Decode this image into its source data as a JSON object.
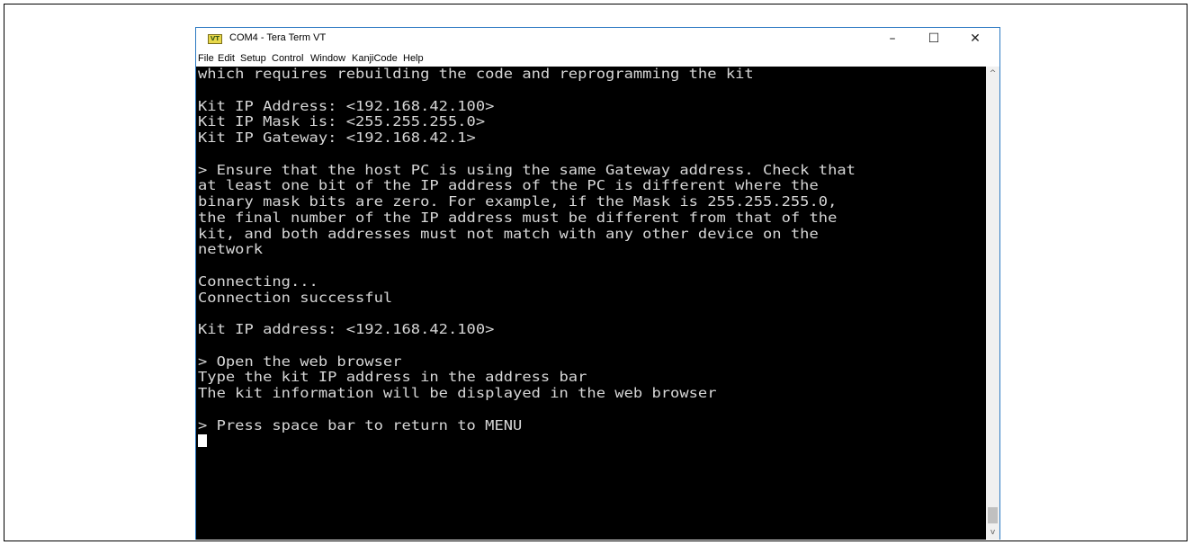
{
  "window": {
    "title": "COM4 - Tera Term VT",
    "icon_text": "VT",
    "controls": {
      "minimize": "–",
      "maximize": "☐",
      "close": "✕"
    }
  },
  "menu": [
    "File",
    "Edit",
    "Setup",
    "Control",
    "Window",
    "KanjiCode",
    "Help"
  ],
  "terminal": {
    "lines": [
      "which requires rebuilding the code and reprogramming the kit",
      "",
      "Kit IP Address: <192.168.42.100>",
      "Kit IP Mask is: <255.255.255.0>",
      "Kit IP Gateway: <192.168.42.1>",
      "",
      "> Ensure that the host PC is using the same Gateway address. Check that",
      "at least one bit of the IP address of the PC is different where the",
      "binary mask bits are zero. For example, if the Mask is 255.255.255.0,",
      "the final number of the IP address must be different from that of the",
      "kit, and both addresses must not match with any other device on the",
      "network",
      "",
      "Connecting...",
      "Connection successful",
      "",
      "Kit IP address: <192.168.42.100>",
      "",
      "> Open the web browser",
      "Type the kit IP address in the address bar",
      "The kit information will be displayed in the web browser",
      "",
      "> Press space bar to return to MENU"
    ]
  },
  "scrollbar": {
    "up_arrow": "^",
    "down_arrow": "v"
  }
}
